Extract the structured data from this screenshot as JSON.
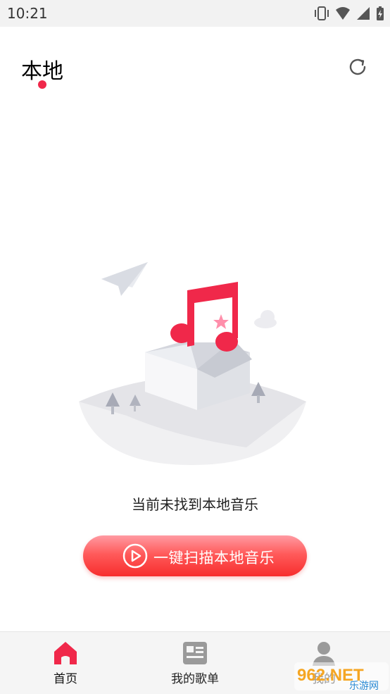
{
  "status_bar": {
    "time": "10:21",
    "icons": [
      "vibrate-icon",
      "wifi-icon",
      "signal-icon",
      "battery-charging-icon"
    ]
  },
  "header": {
    "title": "本地",
    "refresh_icon": "refresh-icon",
    "accent_color": "#f0284a"
  },
  "empty_state": {
    "illustration": "music-box-illustration",
    "message": "当前未找到本地音乐"
  },
  "scan_button": {
    "label": "一键扫描本地音乐",
    "icon": "play-circle-icon"
  },
  "bottom_nav": {
    "items": [
      {
        "label": "首页",
        "icon": "home-icon",
        "active": true
      },
      {
        "label": "我的歌单",
        "icon": "playlist-icon",
        "active": false
      },
      {
        "label": "我的",
        "icon": "profile-icon",
        "active": false
      }
    ]
  },
  "watermark": {
    "brand": "962.NET",
    "sub": "乐游网"
  }
}
